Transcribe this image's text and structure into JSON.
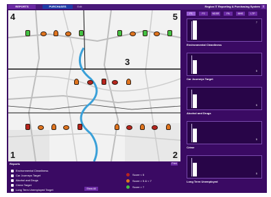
{
  "header": {
    "tabs": [
      {
        "label": "REPORTS"
      },
      {
        "label": "PURCHASES"
      },
      {
        "label": "Edit"
      }
    ],
    "app_title": "Region IT Reporting & Purchasing System",
    "close_label": "x"
  },
  "map": {
    "regions": [
      "1",
      "2",
      "3",
      "4",
      "5"
    ]
  },
  "reports": {
    "title": "Reports",
    "print_label": "Print",
    "show_all_label": "Show All",
    "layers": [
      {
        "label": "Environmental Cleanliness",
        "icon": "tree-icon"
      },
      {
        "label": "Car Journeys Target",
        "icon": "car-icon"
      },
      {
        "label": "Alcohol and Drugs",
        "icon": "bottle-icon"
      },
      {
        "label": "Crime Target",
        "icon": "crime-icon"
      },
      {
        "label": "Long Term Unemployed Target",
        "icon": "person-icon"
      }
    ],
    "scores": [
      {
        "label": "Score < 5",
        "color": "#b8251e"
      },
      {
        "label": "Score > 5 & < 7",
        "color": "#e0751f"
      },
      {
        "label": "Score > 7",
        "color": "#44c144"
      }
    ]
  },
  "panel": {
    "tabs": [
      "P1",
      "P2",
      "NDSR",
      "PA",
      "MHS",
      "LTP"
    ],
    "active_tab": "P1",
    "charts": [
      {
        "label": "Environmental Cleanliness",
        "value": 7,
        "scale_top": "7",
        "scale_mid": ""
      },
      {
        "label": "Car Journeys Target",
        "value": 5,
        "scale_top": "",
        "scale_mid": "5"
      },
      {
        "label": "Alcohol and Drugs",
        "value": 5,
        "scale_top": "",
        "scale_mid": "5"
      },
      {
        "label": "Crime",
        "value": 5,
        "scale_top": "",
        "scale_mid": "5"
      },
      {
        "label": "Long Term Unemployed",
        "value": 5,
        "scale_top": "",
        "scale_mid": "5"
      }
    ]
  }
}
